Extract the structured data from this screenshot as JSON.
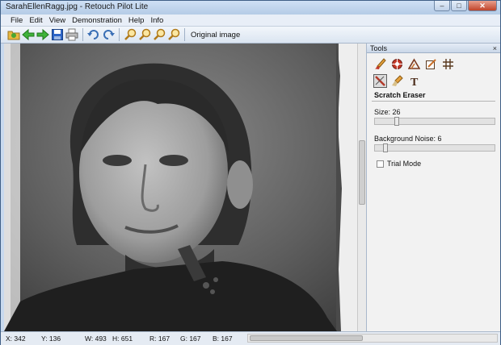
{
  "window": {
    "title": "SarahEllenRagg.jpg - Retouch Pilot Lite",
    "min": "–",
    "max": "□",
    "close": "✕"
  },
  "menu": [
    "File",
    "Edit",
    "View",
    "Demonstration",
    "Help",
    "Info"
  ],
  "toolbar": {
    "icons": [
      "open-folder-icon",
      "back-arrow-icon",
      "forward-arrow-icon",
      "save-icon",
      "print-icon",
      "undo-icon",
      "redo-icon",
      "zoom-in-icon",
      "zoom-out-icon",
      "zoom-fit-icon",
      "zoom-actual-icon"
    ],
    "original_label": "Original image"
  },
  "tools_panel": {
    "title": "Tools",
    "close": "×",
    "row1_icons": [
      "brush-tool-icon",
      "clone-tool-icon",
      "triangle-tool-icon",
      "crop-tool-icon",
      "grid-tool-icon"
    ],
    "row2_icons": [
      "scratch-eraser-icon",
      "healing-brush-icon",
      "text-tool-icon"
    ],
    "tool_name": "Scratch Eraser",
    "size_label": "Size: 26",
    "size_value": 26,
    "noise_label": "Background Noise: 6",
    "noise_value": 6,
    "trial_mode_label": "Trial Mode"
  },
  "status": {
    "x": "X: 342",
    "y": "Y: 136",
    "w": "W: 493",
    "h": "H: 651",
    "r": "R: 167",
    "g": "G: 167",
    "b": "B: 167"
  },
  "colors": {
    "accent": "#3f5f86",
    "panel": "#f2f2f2",
    "status": "#e5ebf3"
  }
}
